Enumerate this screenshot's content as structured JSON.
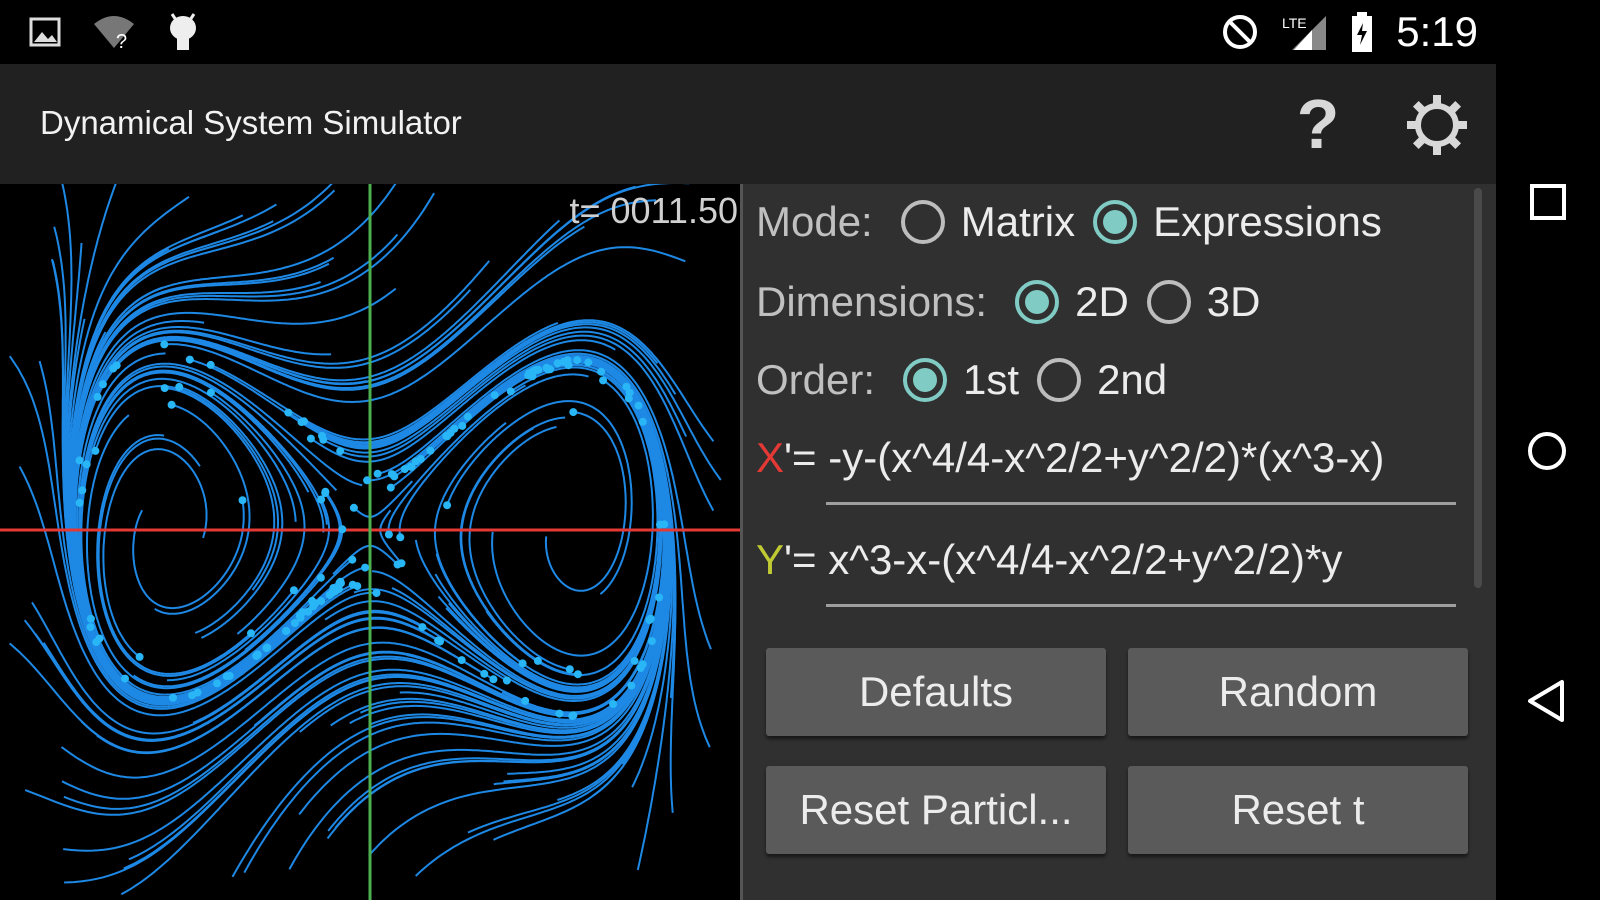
{
  "status_bar": {
    "time": "5:19",
    "icons": [
      "image-icon",
      "wifi-unknown-icon",
      "android-debug-icon",
      "do-not-disturb-icon",
      "lte-signal-icon",
      "battery-charging-icon"
    ]
  },
  "app_bar": {
    "title": "Dynamical System Simulator",
    "help_label": "?",
    "settings_icon": "gear-icon"
  },
  "plot": {
    "time_label": "t= 0011.50",
    "x_axis_color": "#e53935",
    "y_axis_color": "#4caf50",
    "trajectory_color": "#1e88e5",
    "particle_color": "#29b6f6"
  },
  "controls": {
    "mode": {
      "label": "Mode:",
      "options": [
        "Matrix",
        "Expressions"
      ],
      "selected": "Expressions"
    },
    "dimensions": {
      "label": "Dimensions:",
      "options": [
        "2D",
        "3D"
      ],
      "selected": "2D"
    },
    "order": {
      "label": "Order:",
      "options": [
        "1st",
        "2nd"
      ],
      "selected": "1st"
    },
    "x_eq": {
      "label": "X",
      "suffix": "'=",
      "value": "-y-(x^4/4-x^2/2+y^2/2)*(x^3-x)"
    },
    "y_eq": {
      "label": "Y",
      "suffix": "'=",
      "value": "x^3-x-(x^4/4-x^2/2+y^2/2)*y"
    },
    "buttons": {
      "defaults": "Defaults",
      "random": "Random",
      "reset_particles": "Reset Particl...",
      "reset_t": "Reset t"
    }
  },
  "nav_bar": {
    "icons": [
      "recents-square-icon",
      "home-circle-icon",
      "back-triangle-icon"
    ]
  }
}
